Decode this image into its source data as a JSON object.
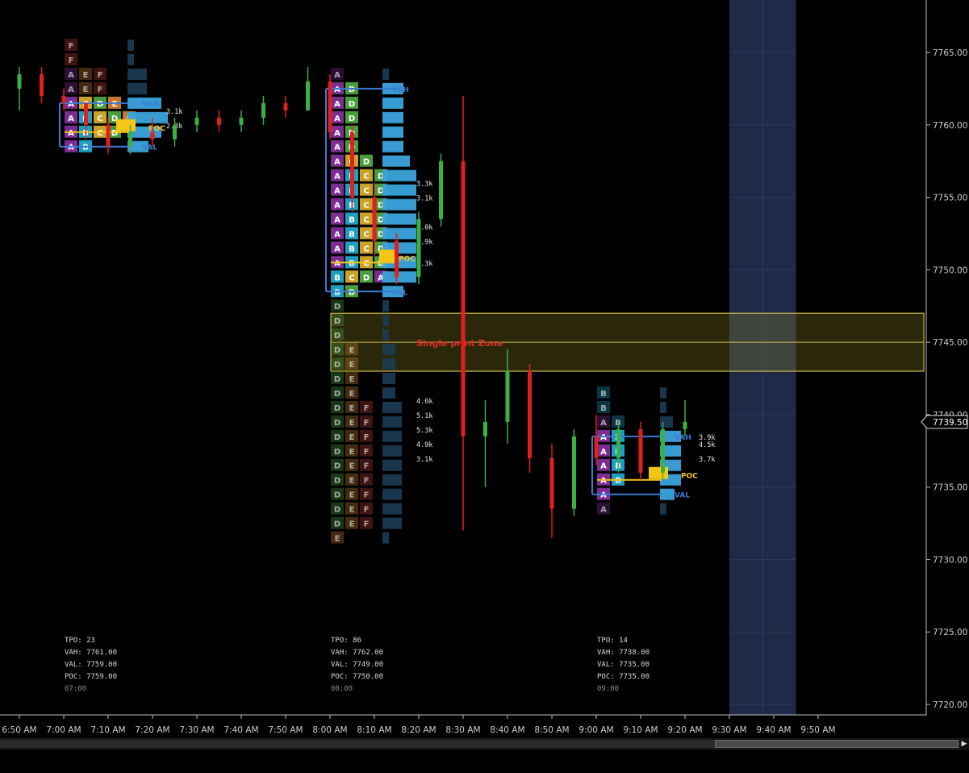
{
  "chart_data": {
    "type": "candlestick-market-profile",
    "y_axis": {
      "ylim": [
        7718.5,
        7767.5
      ],
      "ticks": [
        "7765.00",
        "7760.00",
        "7755.00",
        "7750.00",
        "7745.00",
        "7740.00",
        "7735.00",
        "7730.00",
        "7725.00",
        "7720.00"
      ],
      "current_price_label": "7739.50"
    },
    "x_axis": {
      "ticks": [
        "6:50 AM",
        "7:00 AM",
        "7:10 AM",
        "7:20 AM",
        "7:30 AM",
        "7:40 AM",
        "7:50 AM",
        "8:00 AM",
        "8:10 AM",
        "8:20 AM",
        "8:30 AM",
        "8:40 AM",
        "8:50 AM",
        "9:00 AM",
        "9:10 AM",
        "9:20 AM",
        "9:30 AM",
        "9:40 AM",
        "9:50 AM"
      ]
    },
    "highlight_band": {
      "from": "9:30 AM",
      "to": "9:45 AM"
    },
    "single_print_zone": {
      "label": "Single print Zone",
      "high": 7747.0,
      "low": 7743.0
    },
    "profiles": [
      {
        "start": "7:00 AM",
        "rows": [
          {
            "price": 7765.5,
            "letters": "F"
          },
          {
            "price": 7764.5,
            "letters": "F"
          },
          {
            "price": 7763.5,
            "letters": "AEF"
          },
          {
            "price": 7762.5,
            "letters": "AEF"
          },
          {
            "price": 7761.5,
            "letters": "ACDE"
          },
          {
            "price": 7760.5,
            "letters": "ABCDE"
          },
          {
            "price": 7759.5,
            "letters": "ABCD"
          },
          {
            "price": 7758.5,
            "letters": "AB"
          }
        ],
        "volume_labels": [
          {
            "price": 7761.0,
            "text": "3.1k"
          },
          {
            "price": 7760.0,
            "text": "2.3k"
          }
        ],
        "vah_label": "VAH",
        "val_label": "VAL",
        "poc_label": "POC",
        "stats": {
          "tpo": "TPO: 23",
          "vah": "VAH: 7761.00",
          "val": "VAL: 7759.00",
          "poc": "POC: 7759.00",
          "time": "07:00"
        }
      },
      {
        "start": "8:00 AM",
        "rows": [
          {
            "price": 7763.5,
            "letters": "A"
          },
          {
            "price": 7762.5,
            "letters": "AD"
          },
          {
            "price": 7761.5,
            "letters": "AD"
          },
          {
            "price": 7760.5,
            "letters": "AD"
          },
          {
            "price": 7759.5,
            "letters": "AD"
          },
          {
            "price": 7758.5,
            "letters": "AD"
          },
          {
            "price": 7757.5,
            "letters": "ACD"
          },
          {
            "price": 7756.5,
            "letters": "ABCD"
          },
          {
            "price": 7755.5,
            "letters": "ABCD"
          },
          {
            "price": 7754.5,
            "letters": "ABCD"
          },
          {
            "price": 7753.5,
            "letters": "ABCD"
          },
          {
            "price": 7752.5,
            "letters": "ABCD"
          },
          {
            "price": 7751.5,
            "letters": "ABCD"
          },
          {
            "price": 7750.5,
            "letters": "ABCD"
          },
          {
            "price": 7749.5,
            "letters": "BCDA"
          },
          {
            "price": 7748.5,
            "letters": "BD"
          },
          {
            "price": 7747.5,
            "letters": "D"
          },
          {
            "price": 7746.5,
            "letters": "D"
          },
          {
            "price": 7745.5,
            "letters": "D"
          },
          {
            "price": 7744.5,
            "letters": "DE"
          },
          {
            "price": 7743.5,
            "letters": "DE"
          },
          {
            "price": 7742.5,
            "letters": "DE"
          },
          {
            "price": 7741.5,
            "letters": "DE"
          },
          {
            "price": 7740.5,
            "letters": "DEF"
          },
          {
            "price": 7739.5,
            "letters": "DEF"
          },
          {
            "price": 7738.5,
            "letters": "DEF"
          },
          {
            "price": 7737.5,
            "letters": "DEF"
          },
          {
            "price": 7736.5,
            "letters": "DEF"
          },
          {
            "price": 7735.5,
            "letters": "DEF"
          },
          {
            "price": 7734.5,
            "letters": "DEF"
          },
          {
            "price": 7733.5,
            "letters": "DEF"
          },
          {
            "price": 7732.5,
            "letters": "DEF"
          },
          {
            "price": 7731.5,
            "letters": "E"
          }
        ],
        "volume_labels": [
          {
            "price": 7756.0,
            "text": "3.3k"
          },
          {
            "price": 7755.0,
            "text": "3.1k"
          },
          {
            "price": 7753.0,
            "text": "3.0k"
          },
          {
            "price": 7752.0,
            "text": "2.9k"
          },
          {
            "price": 7750.5,
            "text": "3.3k"
          },
          {
            "price": 7741.0,
            "text": "4.6k"
          },
          {
            "price": 7740.0,
            "text": "5.1k"
          },
          {
            "price": 7739.0,
            "text": "5.3k"
          },
          {
            "price": 7738.0,
            "text": "4.9k"
          },
          {
            "price": 7737.0,
            "text": "3.1k"
          }
        ],
        "vah_label": "VAH",
        "val_label": "VAL",
        "poc_label": "POC",
        "stats": {
          "tpo": "TPO: 86",
          "vah": "VAH: 7762.00",
          "val": "VAL: 7749.00",
          "poc": "POC: 7750.00",
          "time": "08:00"
        }
      },
      {
        "start": "9:00 AM",
        "rows": [
          {
            "price": 7741.5,
            "letters": "B"
          },
          {
            "price": 7740.5,
            "letters": "B"
          },
          {
            "price": 7739.5,
            "letters": "AB"
          },
          {
            "price": 7738.5,
            "letters": "AB"
          },
          {
            "price": 7737.5,
            "letters": "AB"
          },
          {
            "price": 7736.5,
            "letters": "AB"
          },
          {
            "price": 7735.5,
            "letters": "AB"
          },
          {
            "price": 7734.5,
            "letters": "A"
          },
          {
            "price": 7733.5,
            "letters": "A"
          }
        ],
        "volume_labels": [
          {
            "price": 7738.5,
            "text": "3.9k"
          },
          {
            "price": 7738.0,
            "text": "4.5k"
          },
          {
            "price": 7737.0,
            "text": "3.7k"
          }
        ],
        "vah_label": "VAH",
        "val_label": "VAL",
        "poc_label": "POC",
        "stats": {
          "tpo": "TPO: 14",
          "vah": "VAH: 7738.00",
          "val": "VAL: 7735.00",
          "poc": "POC: 7735.00",
          "time": "09:00"
        }
      }
    ],
    "candles_ohlc": [
      {
        "t": "6:50 AM",
        "o": 7762.5,
        "h": 7764.0,
        "l": 7761.0,
        "c": 7763.5
      },
      {
        "t": "6:55 AM",
        "o": 7763.5,
        "h": 7764.0,
        "l": 7761.5,
        "c": 7762.0
      },
      {
        "t": "7:00 AM",
        "o": 7762.0,
        "h": 7762.5,
        "l": 7761.0,
        "c": 7761.5
      },
      {
        "t": "7:05 AM",
        "o": 7761.5,
        "h": 7761.5,
        "l": 7759.0,
        "c": 7760.0
      },
      {
        "t": "7:10 AM",
        "o": 7760.0,
        "h": 7760.5,
        "l": 7758.0,
        "c": 7758.5
      },
      {
        "t": "7:15 AM",
        "o": 7758.5,
        "h": 7760.0,
        "l": 7758.0,
        "c": 7759.5
      },
      {
        "t": "7:20 AM",
        "o": 7759.5,
        "h": 7760.5,
        "l": 7758.5,
        "c": 7759.0
      },
      {
        "t": "7:25 AM",
        "o": 7759.0,
        "h": 7760.5,
        "l": 7758.5,
        "c": 7760.0
      },
      {
        "t": "7:30 AM",
        "o": 7760.0,
        "h": 7761.0,
        "l": 7759.5,
        "c": 7760.5
      },
      {
        "t": "7:35 AM",
        "o": 7760.5,
        "h": 7761.0,
        "l": 7759.5,
        "c": 7760.0
      },
      {
        "t": "7:40 AM",
        "o": 7760.0,
        "h": 7761.0,
        "l": 7759.5,
        "c": 7760.5
      },
      {
        "t": "7:45 AM",
        "o": 7760.5,
        "h": 7762.0,
        "l": 7760.0,
        "c": 7761.5
      },
      {
        "t": "7:50 AM",
        "o": 7761.5,
        "h": 7762.0,
        "l": 7760.5,
        "c": 7761.0
      },
      {
        "t": "7:55 AM",
        "o": 7761.0,
        "h": 7764.0,
        "l": 7761.0,
        "c": 7763.0
      },
      {
        "t": "8:00 AM",
        "o": 7763.0,
        "h": 7763.5,
        "l": 7759.0,
        "c": 7759.5
      },
      {
        "t": "8:05 AM",
        "o": 7759.5,
        "h": 7760.0,
        "l": 7754.0,
        "c": 7755.0
      },
      {
        "t": "8:10 AM",
        "o": 7755.0,
        "h": 7756.0,
        "l": 7751.0,
        "c": 7752.0
      },
      {
        "t": "8:15 AM",
        "o": 7752.0,
        "h": 7752.5,
        "l": 7749.0,
        "c": 7749.5
      },
      {
        "t": "8:20 AM",
        "o": 7749.5,
        "h": 7754.0,
        "l": 7749.0,
        "c": 7753.5
      },
      {
        "t": "8:25 AM",
        "o": 7753.5,
        "h": 7758.0,
        "l": 7753.0,
        "c": 7757.5
      },
      {
        "t": "8:30 AM",
        "o": 7757.5,
        "h": 7762.0,
        "l": 7732.0,
        "c": 7738.5
      },
      {
        "t": "8:35 AM",
        "o": 7738.5,
        "h": 7741.0,
        "l": 7735.0,
        "c": 7739.5
      },
      {
        "t": "8:40 AM",
        "o": 7739.5,
        "h": 7744.5,
        "l": 7738.0,
        "c": 7743.0
      },
      {
        "t": "8:45 AM",
        "o": 7743.0,
        "h": 7743.5,
        "l": 7736.0,
        "c": 7737.0
      },
      {
        "t": "8:50 AM",
        "o": 7737.0,
        "h": 7738.0,
        "l": 7731.5,
        "c": 7733.5
      },
      {
        "t": "8:55 AM",
        "o": 7733.5,
        "h": 7739.0,
        "l": 7733.0,
        "c": 7738.5
      },
      {
        "t": "9:00 AM",
        "o": 7738.5,
        "h": 7740.0,
        "l": 7736.5,
        "c": 7737.0
      },
      {
        "t": "9:05 AM",
        "o": 7737.0,
        "h": 7739.5,
        "l": 7736.0,
        "c": 7739.0
      },
      {
        "t": "9:10 AM",
        "o": 7739.0,
        "h": 7739.5,
        "l": 7735.5,
        "c": 7736.0
      },
      {
        "t": "9:15 AM",
        "o": 7736.0,
        "h": 7739.5,
        "l": 7735.5,
        "c": 7739.0
      },
      {
        "t": "9:20 AM",
        "o": 7739.0,
        "h": 7741.0,
        "l": 7738.5,
        "c": 7739.5
      }
    ],
    "colors": {
      "up": "#3cb043",
      "down": "#e02020",
      "vah_line": "#3a7bd5",
      "poc": "#f5c518",
      "volume": "#3ba3dc",
      "zone": "#c8b84a",
      "band": "#1e2a47",
      "axis_text": "#cfcfcf"
    }
  }
}
